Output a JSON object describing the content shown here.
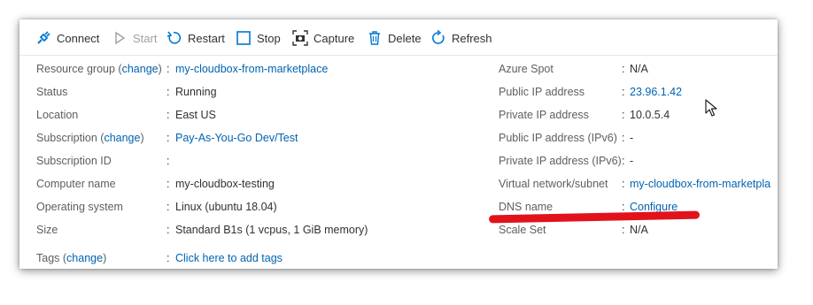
{
  "toolbar": {
    "connect": "Connect",
    "start": "Start",
    "restart": "Restart",
    "stop": "Stop",
    "capture": "Capture",
    "delete": "Delete",
    "refresh": "Refresh"
  },
  "left": {
    "resource_group": {
      "label": "Resource group",
      "change": "change",
      "value": "my-cloudbox-from-marketplace"
    },
    "status": {
      "label": "Status",
      "value": "Running"
    },
    "location": {
      "label": "Location",
      "value": "East US"
    },
    "subscription": {
      "label": "Subscription",
      "change": "change",
      "value": "Pay-As-You-Go Dev/Test"
    },
    "subscription_id": {
      "label": "Subscription ID",
      "value": ""
    },
    "computer_name": {
      "label": "Computer name",
      "value": "my-cloudbox-testing"
    },
    "os": {
      "label": "Operating system",
      "value": "Linux (ubuntu 18.04)"
    },
    "size": {
      "label": "Size",
      "value": "Standard B1s (1 vcpus, 1 GiB memory)"
    },
    "tags": {
      "label": "Tags",
      "change": "change",
      "value": "Click here to add tags"
    }
  },
  "right": {
    "azure_spot": {
      "label": "Azure Spot",
      "value": "N/A"
    },
    "public_ip": {
      "label": "Public IP address",
      "value": "23.96.1.42"
    },
    "private_ip": {
      "label": "Private IP address",
      "value": "10.0.5.4"
    },
    "public_ipv6": {
      "label": "Public IP address (IPv6)",
      "value": "-"
    },
    "private_ipv6": {
      "label": "Private IP address (IPv6)",
      "value": "-"
    },
    "vnet": {
      "label": "Virtual network/subnet",
      "value": "my-cloudbox-from-marketpla"
    },
    "dns": {
      "label": "DNS name",
      "value": "Configure"
    },
    "scale_set": {
      "label": "Scale Set",
      "value": "N/A"
    }
  },
  "colors": {
    "link": "#0063b1",
    "annotation": "#e2121b"
  }
}
